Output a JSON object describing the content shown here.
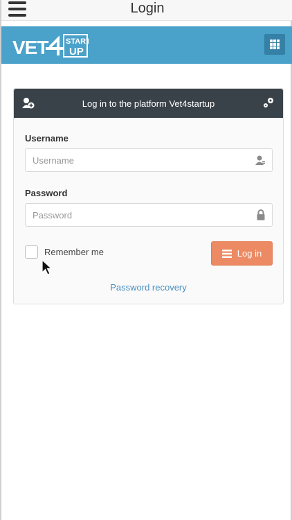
{
  "header": {
    "title": "Login"
  },
  "brand": {
    "logo_text_1": "VET",
    "logo_text_2": "START",
    "logo_text_3": "UP"
  },
  "login": {
    "heading": "Log in to the platform Vet4startup",
    "username_label": "Username",
    "username_placeholder": "Username",
    "username_value": "",
    "password_label": "Password",
    "password_placeholder": "Password",
    "password_value": "",
    "remember_label": "Remember me",
    "remember_checked": false,
    "login_button": "Log in",
    "recovery_link": "Password recovery"
  },
  "icons": {
    "menu": "hamburger-icon",
    "apps": "grid-icon",
    "add_user": "add-user-icon",
    "settings": "gears-icon",
    "user": "user-icon",
    "lock": "lock-icon",
    "list": "list-icon",
    "cursor": "mouse-cursor-icon"
  },
  "colors": {
    "brand_bar": "#4aa1c9",
    "apps_button": "#3580a6",
    "card_header": "#3a4249",
    "login_button": "#ec8a63",
    "link": "#4a8fbe"
  }
}
